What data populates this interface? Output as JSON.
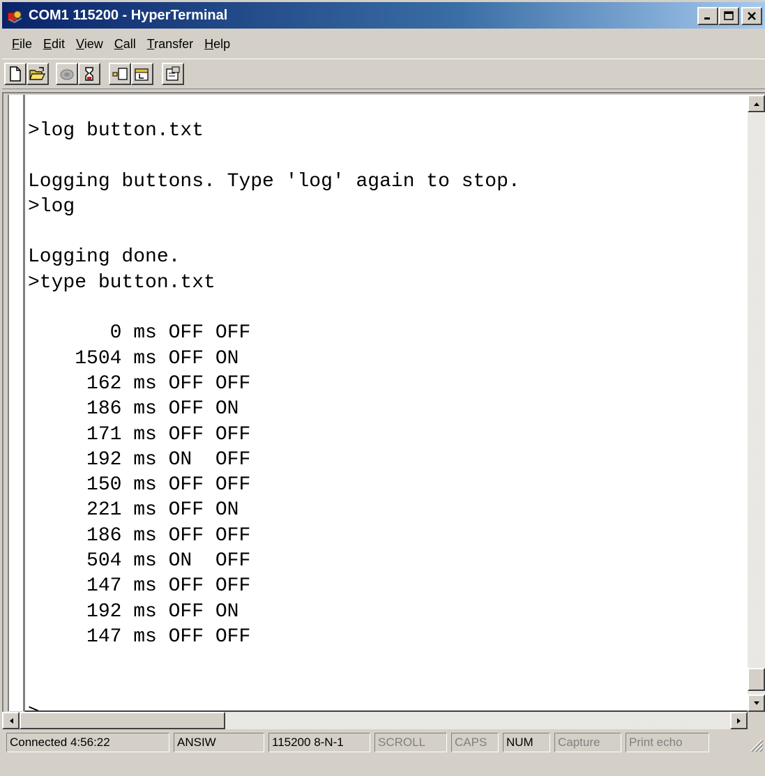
{
  "window": {
    "title": "COM1 115200 - HyperTerminal",
    "controls": [
      "minimize-icon",
      "maximize-icon",
      "close-icon"
    ]
  },
  "menu": {
    "items": [
      {
        "label": "File",
        "accel": "F",
        "rest": "ile"
      },
      {
        "label": "Edit",
        "accel": "E",
        "rest": "dit"
      },
      {
        "label": "View",
        "accel": "V",
        "rest": "iew"
      },
      {
        "label": "Call",
        "accel": "C",
        "rest": "all"
      },
      {
        "label": "Transfer",
        "accel": "T",
        "rest": "ransfer"
      },
      {
        "label": "Help",
        "accel": "H",
        "rest": "elp"
      }
    ]
  },
  "toolbar": {
    "icons": [
      "new-icon",
      "open-icon",
      "call-icon",
      "disconnect-icon",
      "send-icon",
      "receive-icon",
      "properties-icon"
    ]
  },
  "terminal": {
    "lines": [
      ">log button.txt",
      "",
      "Logging buttons. Type 'log' again to stop.",
      ">log",
      "",
      "Logging done.",
      ">type button.txt",
      "",
      "       0 ms OFF OFF",
      "    1504 ms OFF ON",
      "     162 ms OFF OFF",
      "     186 ms OFF ON",
      "     171 ms OFF OFF",
      "     192 ms ON  OFF",
      "     150 ms OFF OFF",
      "     221 ms OFF ON",
      "     186 ms OFF OFF",
      "     504 ms ON  OFF",
      "     147 ms OFF OFF",
      "     192 ms OFF ON",
      "     147 ms OFF OFF",
      "",
      "",
      ">"
    ]
  },
  "status": {
    "connected": "Connected 4:56:22",
    "emulation": "ANSIW",
    "settings": "115200 8-N-1",
    "scroll": "SCROLL",
    "caps": "CAPS",
    "num": "NUM",
    "capture": "Capture",
    "print_echo": "Print echo"
  },
  "colors": {
    "title_start": "#0a246a",
    "title_end": "#a6caf0",
    "face": "#d4d0c8",
    "terminal_bg": "#ffffff",
    "terminal_fg": "#000000"
  }
}
